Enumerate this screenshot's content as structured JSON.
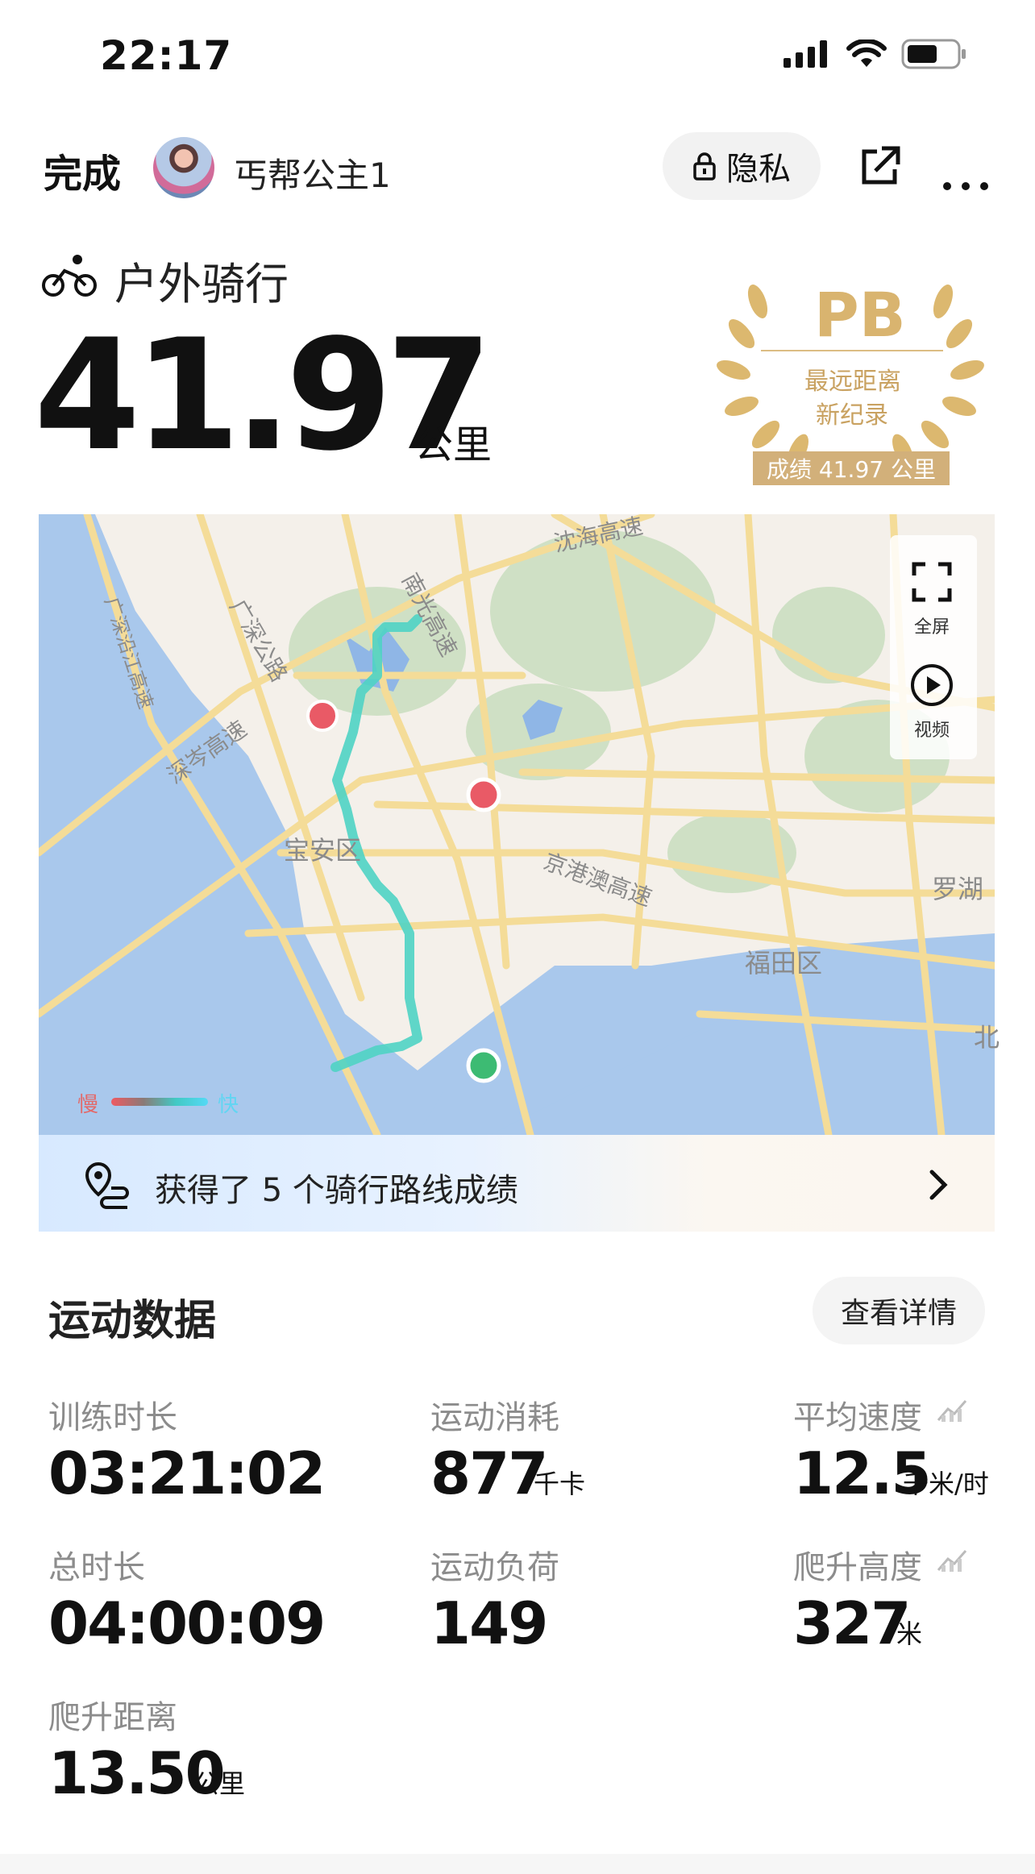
{
  "status_bar": {
    "time": "22:17"
  },
  "header": {
    "done_label": "完成",
    "username": "丐帮公主1",
    "privacy_label": "隐私"
  },
  "activity": {
    "type": "户外骑行",
    "distance": "41.97",
    "distance_unit": "公里"
  },
  "pb_badge": {
    "title": "PB",
    "line1": "最远距离",
    "line2": "新纪录",
    "score": "成绩 41.97 公里"
  },
  "map": {
    "controls": {
      "fullscreen": "全屏",
      "video": "视频"
    },
    "legend": {
      "slow": "慢",
      "fast": "快"
    },
    "place_labels": {
      "baoan": "宝安区",
      "futian": "福田区",
      "luohu": "罗湖",
      "bei": "北",
      "jinggangao": "京港澳高速",
      "shenhai": "沈海高速",
      "nanguang": "南光高速",
      "guangshen": "广深公路",
      "yanjiang": "广深沿江高速",
      "shencen": "深岑高速"
    },
    "route_color": "#4fd3c4",
    "start_color": "#3dbb73",
    "end_color": "#e95a66"
  },
  "route_banner": {
    "text": "获得了 5 个骑行路线成绩"
  },
  "sports_data": {
    "title": "运动数据",
    "details_label": "查看详情",
    "stats": {
      "training_time": {
        "label": "训练时长",
        "value": "03:21:02",
        "unit": ""
      },
      "calories": {
        "label": "运动消耗",
        "value": "877",
        "unit": "千卡"
      },
      "avg_speed": {
        "label": "平均速度",
        "value": "12.5",
        "unit": "千米/时"
      },
      "total_time": {
        "label": "总时长",
        "value": "04:00:09",
        "unit": ""
      },
      "load": {
        "label": "运动负荷",
        "value": "149",
        "unit": ""
      },
      "elevation": {
        "label": "爬升高度",
        "value": "327",
        "unit": "米"
      },
      "climb_distance": {
        "label": "爬升距离",
        "value": "13.50",
        "unit": "公里"
      }
    }
  }
}
